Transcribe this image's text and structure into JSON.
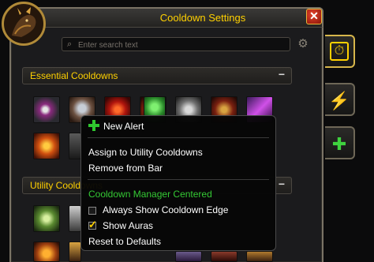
{
  "window": {
    "title": "Cooldown Settings",
    "close_label": "✕"
  },
  "search": {
    "placeholder": "Enter search text"
  },
  "sections": [
    {
      "label": "Essential Cooldowns",
      "collapse": "−"
    },
    {
      "label": "Utility Cooldowns",
      "collapse": "−"
    }
  ],
  "side_tabs": [
    {
      "name": "cooldowns",
      "icon": "stopwatch-icon",
      "glyph": "⏱",
      "active": true
    },
    {
      "name": "buffs",
      "icon": "lightning-icon",
      "glyph": "⚡",
      "active": false
    },
    {
      "name": "add",
      "icon": "plus-icon",
      "glyph": "✚",
      "active": false
    }
  ],
  "context_menu": {
    "new_alert": "New Alert",
    "assign": "Assign to Utility Cooldowns",
    "remove": "Remove from Bar",
    "header": "Cooldown Manager Centered",
    "always_show_edge": {
      "label": "Always Show Cooldown Edge",
      "checked": false
    },
    "show_auras": {
      "label": "Show Auras",
      "checked": true
    },
    "reset": "Reset to Defaults"
  },
  "colors": {
    "accent": "#ffd100",
    "menu_header": "#34c934",
    "close_button": "#c0281a"
  }
}
